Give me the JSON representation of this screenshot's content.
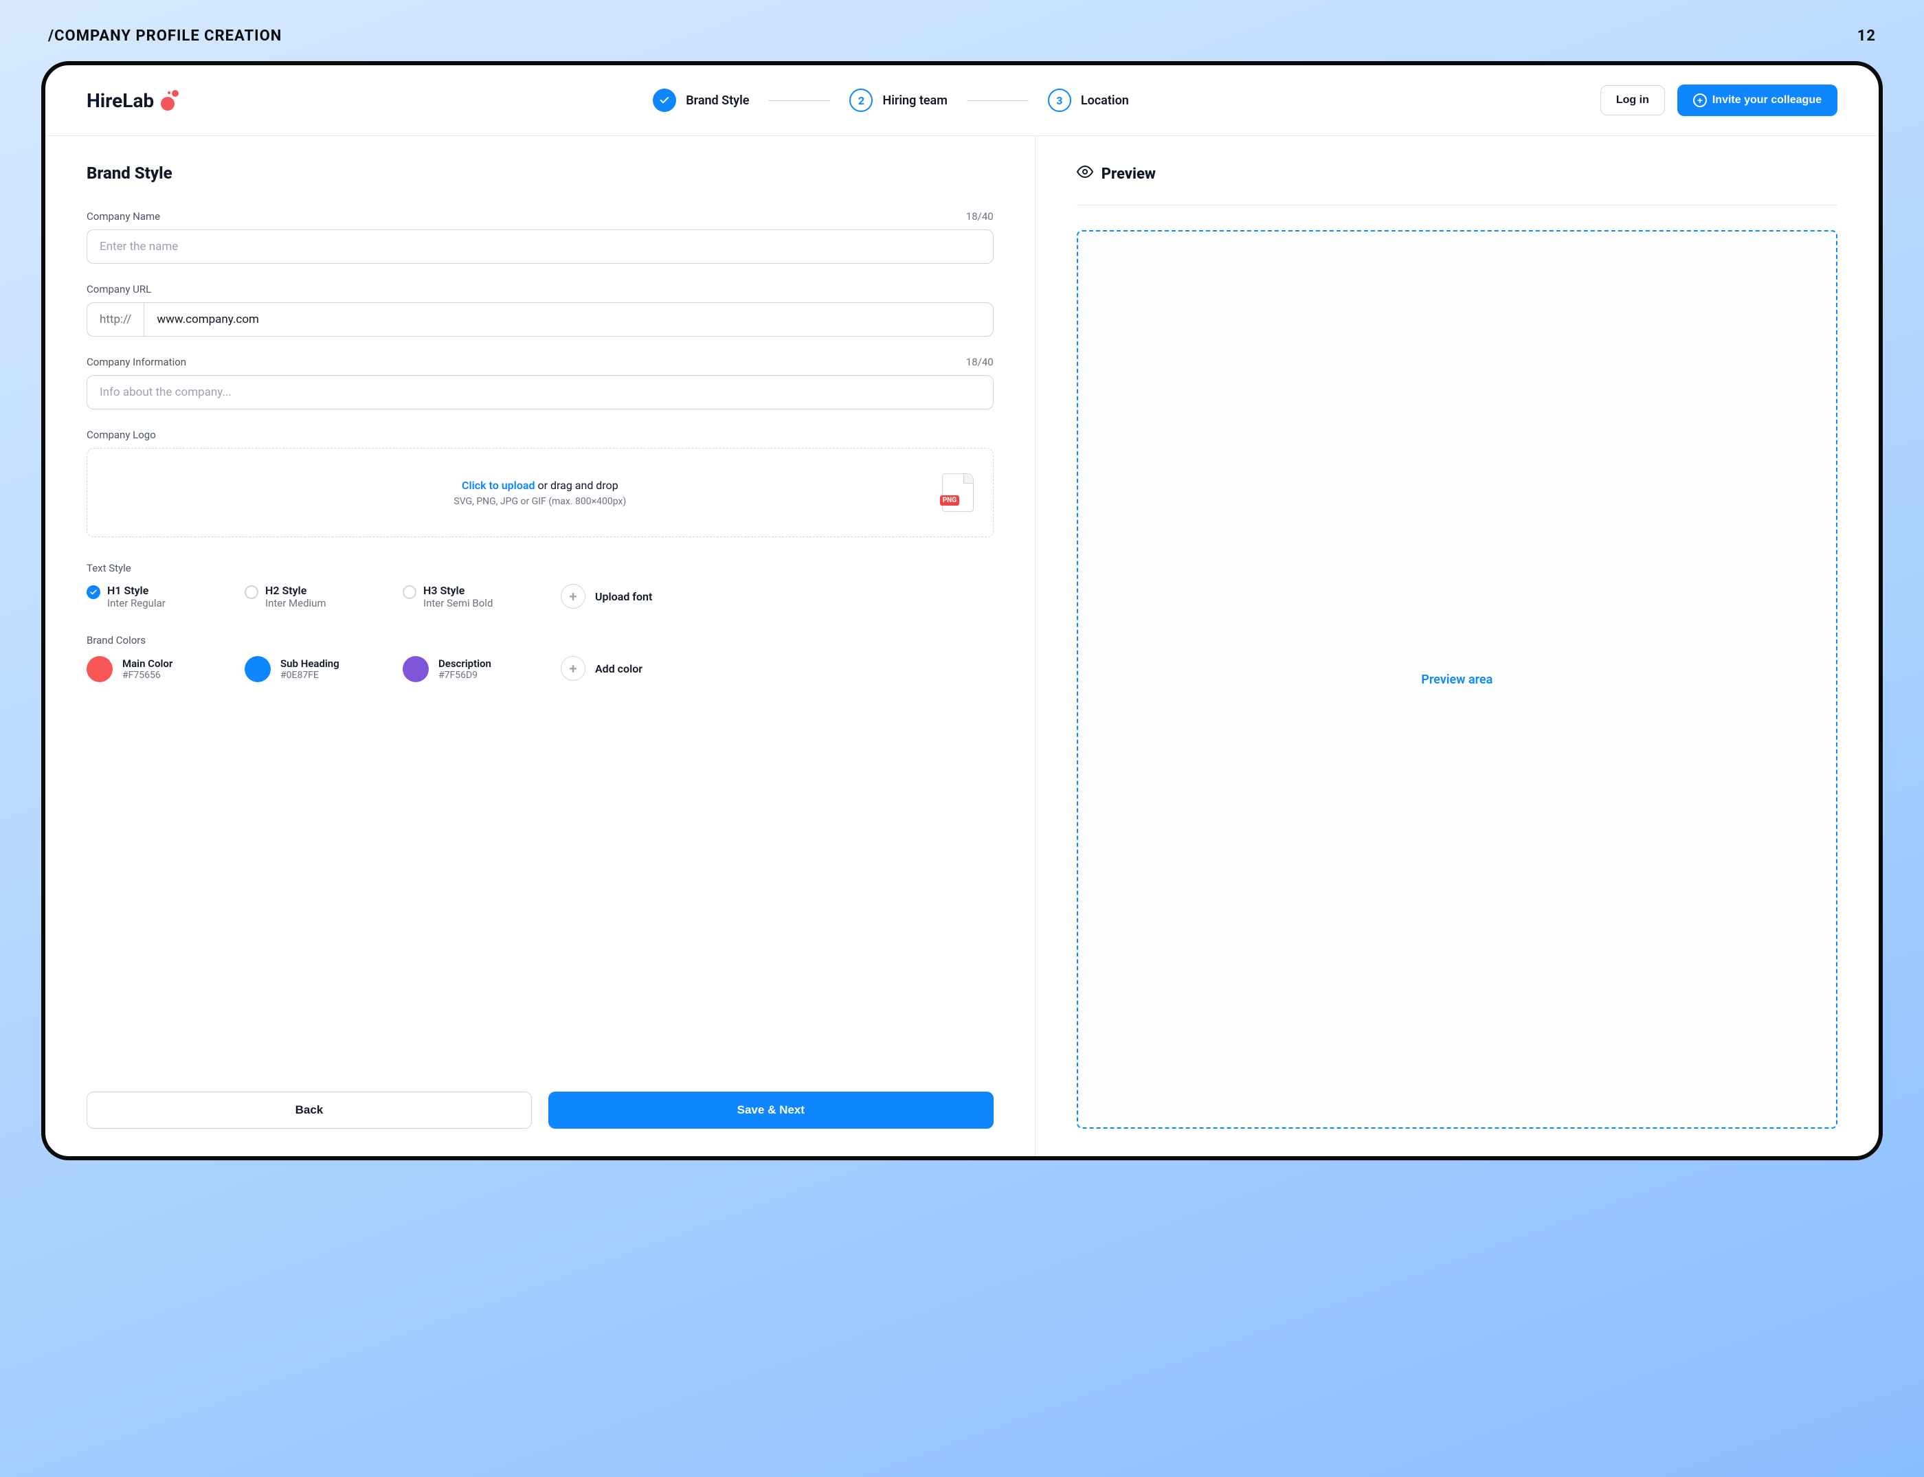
{
  "meta": {
    "page_label": "/COMPANY PROFILE CREATION",
    "page_number": "12"
  },
  "logo": {
    "text": "HireLab"
  },
  "stepper": {
    "steps": [
      {
        "label": "Brand Style",
        "indicator": "✓",
        "status": "done"
      },
      {
        "label": "Hiring team",
        "indicator": "2",
        "status": "current"
      },
      {
        "label": "Location",
        "indicator": "3",
        "status": "upcoming"
      }
    ]
  },
  "actions": {
    "login": "Log in",
    "invite": "Invite your colleague"
  },
  "form": {
    "title": "Brand Style",
    "company_name": {
      "label": "Company Name",
      "counter": "18/40",
      "placeholder": "Enter the name",
      "value": ""
    },
    "company_url": {
      "label": "Company URL",
      "prefix": "http://",
      "value": "www.company.com"
    },
    "company_info": {
      "label": "Company Information",
      "counter": "18/40",
      "placeholder": "Info about the company...",
      "value": ""
    },
    "logo_upload": {
      "label": "Company Logo",
      "cta_link": "Click to upload",
      "cta_rest": " or drag and drop",
      "hint": "SVG, PNG, JPG or GIF (max. 800×400px)",
      "thumb_tag": "PNG"
    },
    "text_style": {
      "label": "Text Style",
      "options": [
        {
          "title": "H1 Style",
          "subtitle": "Inter Regular",
          "selected": true
        },
        {
          "title": "H2 Style",
          "subtitle": "Inter Medium",
          "selected": false
        },
        {
          "title": "H3 Style",
          "subtitle": "Inter Semi Bold",
          "selected": false
        }
      ],
      "upload_font": "Upload font"
    },
    "brand_colors": {
      "label": "Brand Colors",
      "colors": [
        {
          "name": "Main Color",
          "hex": "#F75656"
        },
        {
          "name": "Sub Heading",
          "hex": "#0E87FE"
        },
        {
          "name": "Description",
          "hex": "#7F56D9"
        }
      ],
      "add_color": "Add color"
    },
    "footer": {
      "back": "Back",
      "next": "Save & Next"
    }
  },
  "preview": {
    "title": "Preview",
    "placeholder": "Preview area"
  }
}
